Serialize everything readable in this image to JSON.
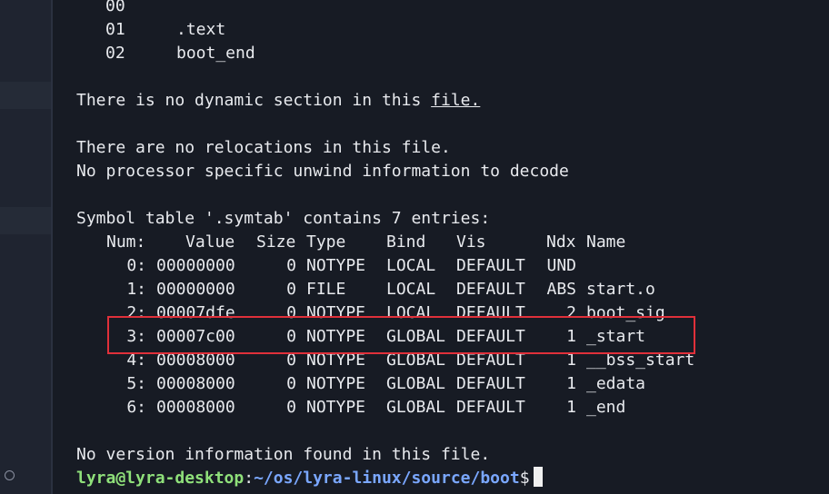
{
  "terminal": {
    "section_rows": [
      {
        "num": "00",
        "sections": ""
      },
      {
        "num": "01",
        "sections": ".text"
      },
      {
        "num": "02",
        "sections": "boot_end"
      }
    ],
    "dynamic_text": "There is no dynamic section in this ",
    "dynamic_link": "file.",
    "relocations": "There are no relocations in this file.",
    "unwind": "No processor specific unwind information to decode",
    "symtab_title": "Symbol table '.symtab' contains 7 entries:",
    "headers": {
      "num": "Num:",
      "value": "Value",
      "size": "Size",
      "type": "Type",
      "bind": "Bind",
      "vis": "Vis",
      "ndx": "Ndx",
      "name": "Name"
    },
    "symbols": [
      {
        "num": "0:",
        "value": "00000000",
        "size": "0",
        "type": "NOTYPE",
        "bind": "LOCAL",
        "vis": "DEFAULT",
        "ndx": "UND",
        "name": ""
      },
      {
        "num": "1:",
        "value": "00000000",
        "size": "0",
        "type": "FILE",
        "bind": "LOCAL",
        "vis": "DEFAULT",
        "ndx": "ABS",
        "name": "start.o"
      },
      {
        "num": "2:",
        "value": "00007dfe",
        "size": "0",
        "type": "NOTYPE",
        "bind": "LOCAL",
        "vis": "DEFAULT",
        "ndx": "2",
        "name": "boot_sig"
      },
      {
        "num": "3:",
        "value": "00007c00",
        "size": "0",
        "type": "NOTYPE",
        "bind": "GLOBAL",
        "vis": "DEFAULT",
        "ndx": "1",
        "name": "_start"
      },
      {
        "num": "4:",
        "value": "00008000",
        "size": "0",
        "type": "NOTYPE",
        "bind": "GLOBAL",
        "vis": "DEFAULT",
        "ndx": "1",
        "name": "__bss_start"
      },
      {
        "num": "5:",
        "value": "00008000",
        "size": "0",
        "type": "NOTYPE",
        "bind": "GLOBAL",
        "vis": "DEFAULT",
        "ndx": "1",
        "name": "_edata"
      },
      {
        "num": "6:",
        "value": "00008000",
        "size": "0",
        "type": "NOTYPE",
        "bind": "GLOBAL",
        "vis": "DEFAULT",
        "ndx": "1",
        "name": "_end"
      }
    ],
    "version_info": "No version information found in this file.",
    "prompt": {
      "user_host": "lyra@lyra-desktop",
      "separator": ":",
      "path": "~/os/lyra-linux/source/boot",
      "symbol": "$"
    }
  },
  "colors": {
    "background": "#171b24",
    "prompt_user": "#8fe07a",
    "prompt_path": "#7aa7ff",
    "highlight": "#e0303a"
  }
}
